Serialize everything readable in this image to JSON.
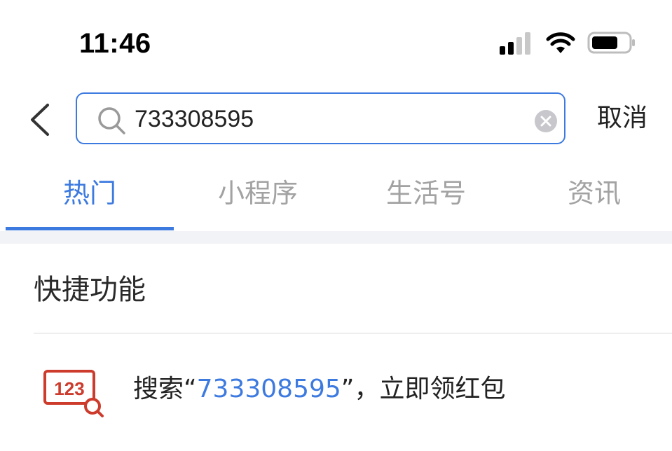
{
  "status_bar": {
    "time": "11:46",
    "signal_icon": "cellular-signal-icon",
    "wifi_icon": "wifi-icon",
    "battery_icon": "battery-icon"
  },
  "search": {
    "back_icon": "chevron-left-icon",
    "search_icon": "search-icon",
    "query": "733308595",
    "clear_icon": "clear-circle-icon",
    "cancel_label": "取消"
  },
  "tabs": [
    {
      "label": "热门",
      "active": true
    },
    {
      "label": "小程序",
      "active": false
    },
    {
      "label": "生活号",
      "active": false
    },
    {
      "label": "资讯",
      "active": false
    }
  ],
  "section": {
    "title": "快捷功能",
    "item": {
      "icon": "number-search-icon",
      "icon_text": "123",
      "prefix": "搜索“",
      "query": "733308595",
      "suffix": "”，立即领红包"
    }
  },
  "colors": {
    "accent": "#3d7ae0",
    "inactive_tab": "#a2a2a2",
    "icon_red": "#cc3b2c",
    "band": "#f2f3f6"
  }
}
